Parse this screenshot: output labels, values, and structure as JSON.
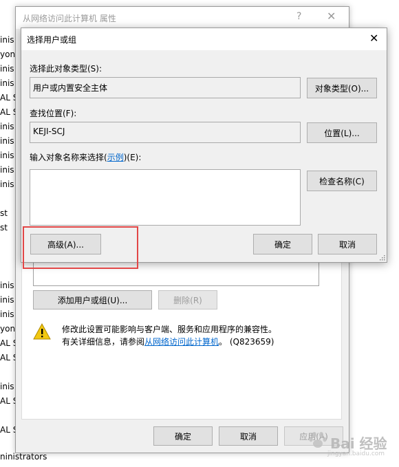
{
  "background_list": {
    "items": [
      "inis",
      "yon",
      "inis",
      "inis",
      "AL S",
      "AL S",
      "inis",
      "inis",
      "inis",
      "inis",
      "inis",
      "st",
      "st",
      "inis",
      "inis",
      "inis",
      "yon",
      "AL S",
      "AL S",
      "inis",
      "AL S",
      "AL S"
    ],
    "bottom": "ninistrators"
  },
  "parent_window": {
    "title": "从网络访问此计算机 属性",
    "help_glyph": "?",
    "close_glyph": "✕",
    "add_button": "添加用户或组(U)...",
    "remove_button": "删除(R)",
    "warning_line1": "修改此设置可能影响与客户端、服务和应用程序的兼容性。",
    "warning_prefix": "有关详细信息，请参阅",
    "warning_link": "从网络访问此计算机",
    "warning_suffix": "。 (Q823659)",
    "ok_button": "确定",
    "cancel_button": "取消",
    "apply_button": "应用(A)"
  },
  "dialog": {
    "title": "选择用户或组",
    "close_glyph": "✕",
    "object_type_label": "选择此对象类型(S):",
    "object_type_value": "用户或内置安全主体",
    "object_type_button": "对象类型(O)...",
    "location_label": "查找位置(F):",
    "location_value": "KEJI-SCJ",
    "location_button": "位置(L)...",
    "names_label_prefix": "输入对象名称来选择(",
    "names_label_link": "示例",
    "names_label_suffix": ")(E):",
    "names_value": "",
    "check_names_button": "检查名称(C)",
    "advanced_button": "高级(A)...",
    "ok_button": "确定",
    "cancel_button": "取消"
  },
  "watermark": {
    "text": "Bai 经验",
    "sub": "jingyan.baidu.com"
  },
  "colors": {
    "highlight": "#e24646",
    "link": "#0066cc",
    "warning": "#f2c811"
  }
}
